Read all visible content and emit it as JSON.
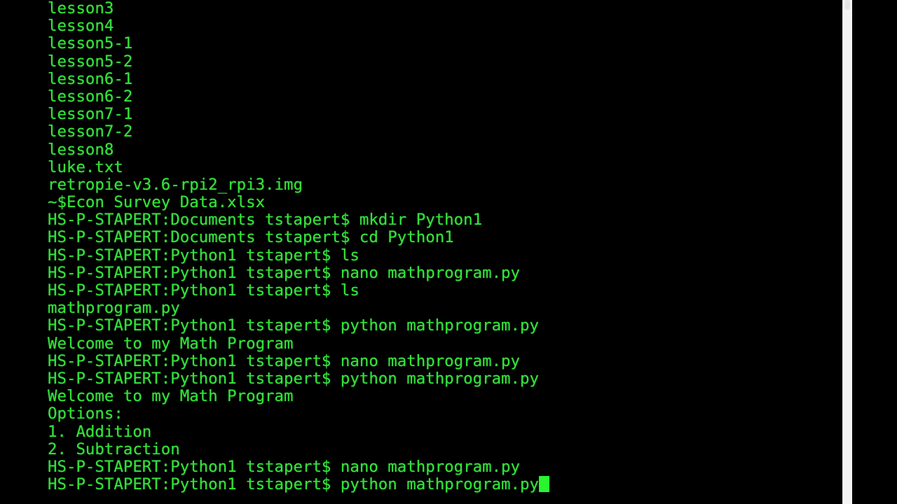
{
  "terminal": {
    "lines": [
      "lesson3",
      "lesson4",
      "lesson5-1",
      "lesson5-2",
      "lesson6-1",
      "lesson6-2",
      "lesson7-1",
      "lesson7-2",
      "lesson8",
      "luke.txt",
      "retropie-v3.6-rpi2_rpi3.img",
      "~$Econ Survey Data.xlsx",
      "HS-P-STAPERT:Documents tstapert$ mkdir Python1",
      "HS-P-STAPERT:Documents tstapert$ cd Python1",
      "HS-P-STAPERT:Python1 tstapert$ ls",
      "HS-P-STAPERT:Python1 tstapert$ nano mathprogram.py",
      "HS-P-STAPERT:Python1 tstapert$ ls",
      "mathprogram.py",
      "HS-P-STAPERT:Python1 tstapert$ python mathprogram.py",
      "Welcome to my Math Program",
      "HS-P-STAPERT:Python1 tstapert$ nano mathprogram.py",
      "HS-P-STAPERT:Python1 tstapert$ python mathprogram.py",
      "Welcome to my Math Program",
      "Options:",
      "1. Addition",
      "2. Subtraction",
      "HS-P-STAPERT:Python1 tstapert$ nano mathprogram.py"
    ],
    "current_line": "HS-P-STAPERT:Python1 tstapert$ python mathprogram.py",
    "text_color": "#33e03a",
    "cursor_color": "#29f52f",
    "background": "#000000"
  }
}
